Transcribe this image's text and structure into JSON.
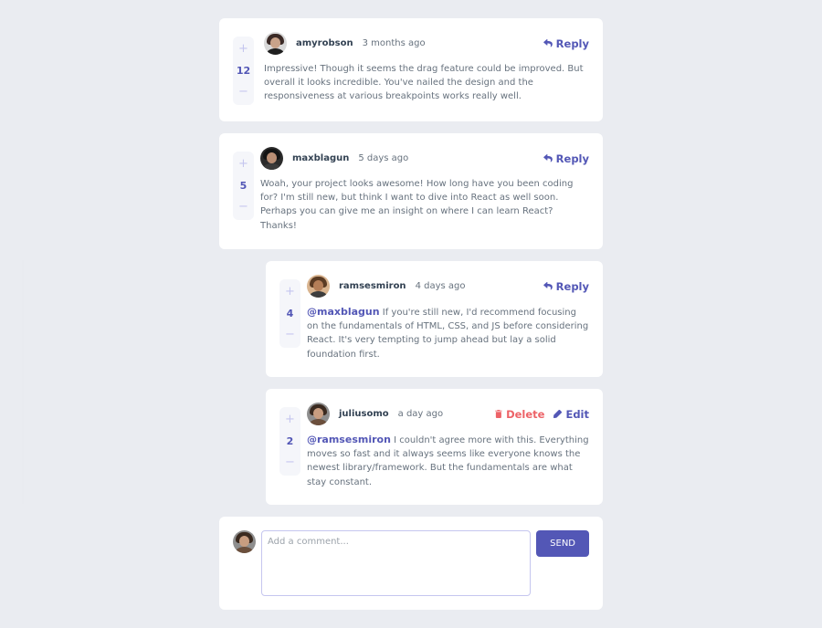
{
  "comments": [
    {
      "username": "amyrobson",
      "created": "3 months ago",
      "score": "12",
      "content": "Impressive! Though it seems the drag feature could be improved. But overall it looks incredible. You've nailed the design and the responsiveness at various breakpoints works really well.",
      "reply_label": "Reply",
      "avatar_colors": {
        "bg": "#d9d9d9",
        "hair": "#3b2a26",
        "face": "#c9a38a",
        "body": "#1f1f1f"
      }
    },
    {
      "username": "maxblagun",
      "created": "5 days ago",
      "score": "5",
      "content": "Woah, your project looks awesome! How long have you been coding for? I'm still new, but think I want to dive into React as well soon. Perhaps you can give me an insight on where I can learn React? Thanks!",
      "reply_label": "Reply",
      "avatar_colors": {
        "bg": "#2b2b2b",
        "hair": "#141414",
        "face": "#b98e74",
        "body": "#3a3a3a"
      }
    }
  ],
  "replies": [
    {
      "username": "ramsesmiron",
      "created": "4 days ago",
      "score": "4",
      "replying_to": "@maxblagun",
      "content": "If you're still new, I'd recommend focusing on the fundamentals of HTML, CSS, and JS before considering React. It's very tempting to jump ahead but lay a solid foundation first.",
      "reply_label": "Reply",
      "avatar_colors": {
        "bg": "#d9b48f",
        "hair": "#5a3b24",
        "face": "#b47e58",
        "body": "#3d3d3d"
      }
    },
    {
      "username": "juliusomo",
      "created": "a day ago",
      "score": "2",
      "replying_to": "@ramsesmiron",
      "content": "I couldn't agree more with this. Everything moves so fast and it always seems like everyone knows the newest library/framework. But the fundamentals are what stay constant.",
      "delete_label": "Delete",
      "edit_label": "Edit",
      "avatar_colors": {
        "bg": "#8e8e8e",
        "hair": "#3a2a20",
        "face": "#c89d80",
        "body": "#6b4f3c"
      }
    }
  ],
  "vote": {
    "plus": "+",
    "minus": "−"
  },
  "form": {
    "placeholder": "Add a comment...",
    "send_label": "SEND",
    "avatar_colors": {
      "bg": "#8e8e8e",
      "hair": "#3a2a20",
      "face": "#c89d80",
      "body": "#6b4f3c"
    }
  },
  "colors": {
    "accent": "#5357b6",
    "accent_light": "#c5c6ef",
    "danger": "#ed6368",
    "background": "#eaecf1",
    "text": "#67727e",
    "heading": "#334253"
  }
}
